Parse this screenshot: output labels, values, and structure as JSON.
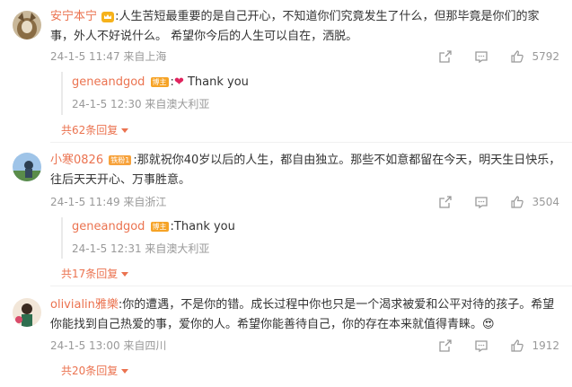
{
  "comments": [
    {
      "user": "安宁本宁",
      "badge_icon": "crown-icon",
      "text": ":人生苦短最重要的是自己开心，不知道你们究竟发生了什么，但那毕竟是你们的家事，外人不好说什么。 希望你今后的人生可以自在，洒脱。",
      "meta": "24-1-5 11:47 来自上海",
      "likes": "5792",
      "reply": {
        "user": "geneandgod",
        "badge": "博主",
        "text": ":",
        "heart": "❤",
        "text2": " Thank you",
        "meta": "24-1-5 12:30 来自澳大利亚"
      },
      "more": "共62条回复"
    },
    {
      "user": "小寒0826",
      "badge": "铁粉1",
      "text": ":那就祝你40岁以后的人生，都自由独立。那些不如意都留在今天，明天生日快乐，往后天天开心、万事胜意。",
      "meta": "24-1-5 11:49 来自浙江",
      "likes": "3504",
      "reply": {
        "user": "geneandgod",
        "badge": "博主",
        "text": ":Thank you",
        "meta": "24-1-5 12:31 来自澳大利亚"
      },
      "more": "共17条回复"
    },
    {
      "user": "olivialin雅樂",
      "text": ":你的遭遇，不是你的错。成长过程中你也只是一个渴求被爱和公平对待的孩子。希望你能找到自己热爱的事，爱你的人。希望你能善待自己，你的存在本来就值得青睐。",
      "emoji": "😍",
      "meta": "24-1-5 13:00 来自四川",
      "likes": "1912",
      "more": "共20条回复"
    }
  ],
  "colors": {
    "accent": "#eb7350",
    "meta": "#999999",
    "text": "#333333"
  }
}
